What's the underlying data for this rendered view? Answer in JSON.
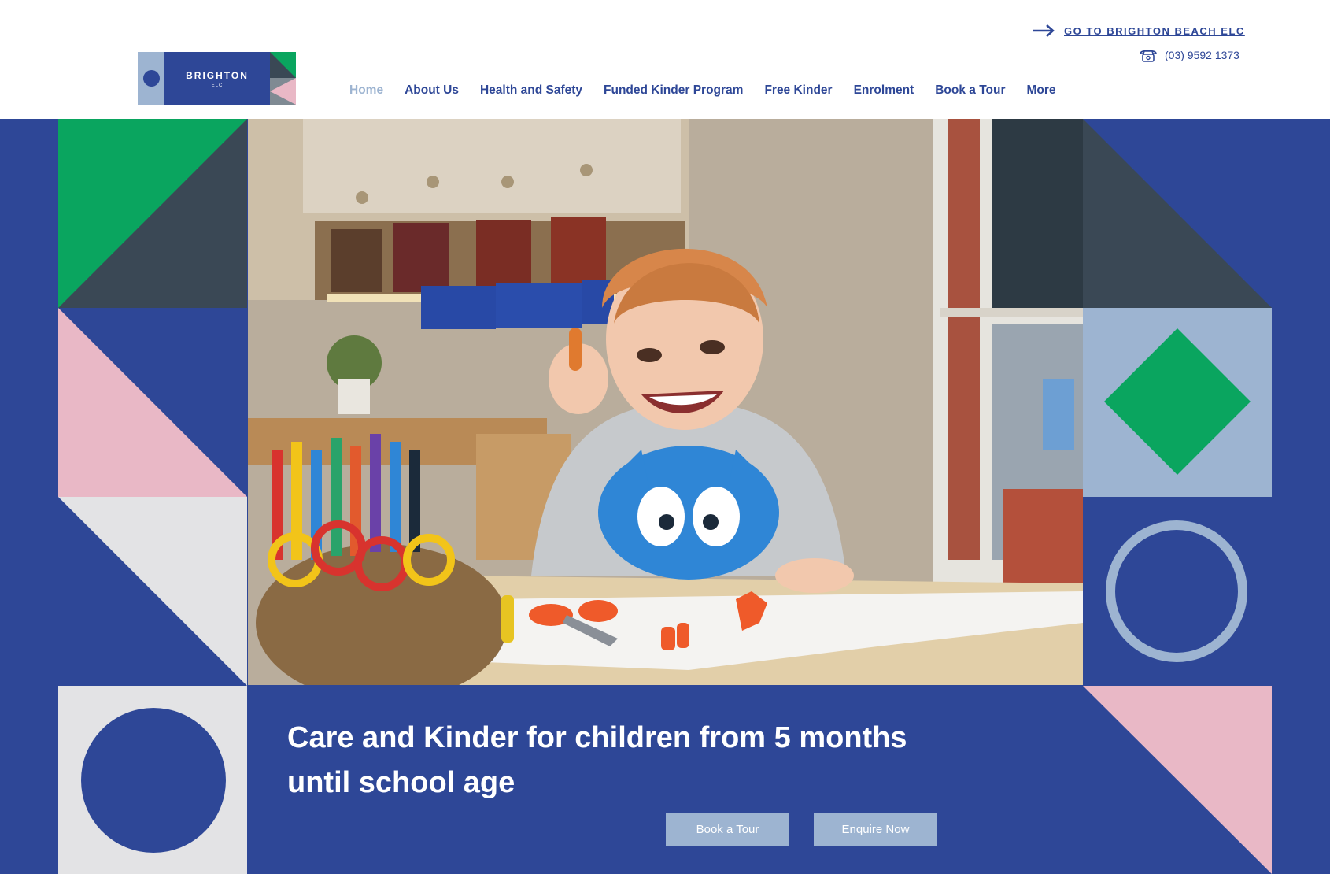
{
  "brand": {
    "name": "BRIGHTON",
    "sub": "ELC",
    "colors": {
      "primary": "#2e4797",
      "light_blue": "#9db4d1",
      "green": "#0aa55f",
      "dark": "#3a4855",
      "pink": "#e9b8c6",
      "light_gray": "#e3e3e5"
    }
  },
  "header": {
    "top_link": {
      "label": "GO TO BRIGHTON BEACH ELC",
      "icon": "arrow-right-icon"
    },
    "phone": {
      "number": "(03) 9592 1373",
      "icon": "phone-icon"
    }
  },
  "nav": {
    "items": [
      {
        "label": "Home",
        "active": true
      },
      {
        "label": "About Us"
      },
      {
        "label": "Health and Safety"
      },
      {
        "label": "Funded Kinder Program"
      },
      {
        "label": "Free Kinder"
      },
      {
        "label": "Enrolment"
      },
      {
        "label": "Book a Tour"
      },
      {
        "label": "More"
      }
    ]
  },
  "hero": {
    "headline_line1": "Care and Kinder for children from 5 months",
    "headline_line2": "until school age",
    "book_tour_label": "Book a Tour",
    "enquire_label": "Enquire Now"
  }
}
